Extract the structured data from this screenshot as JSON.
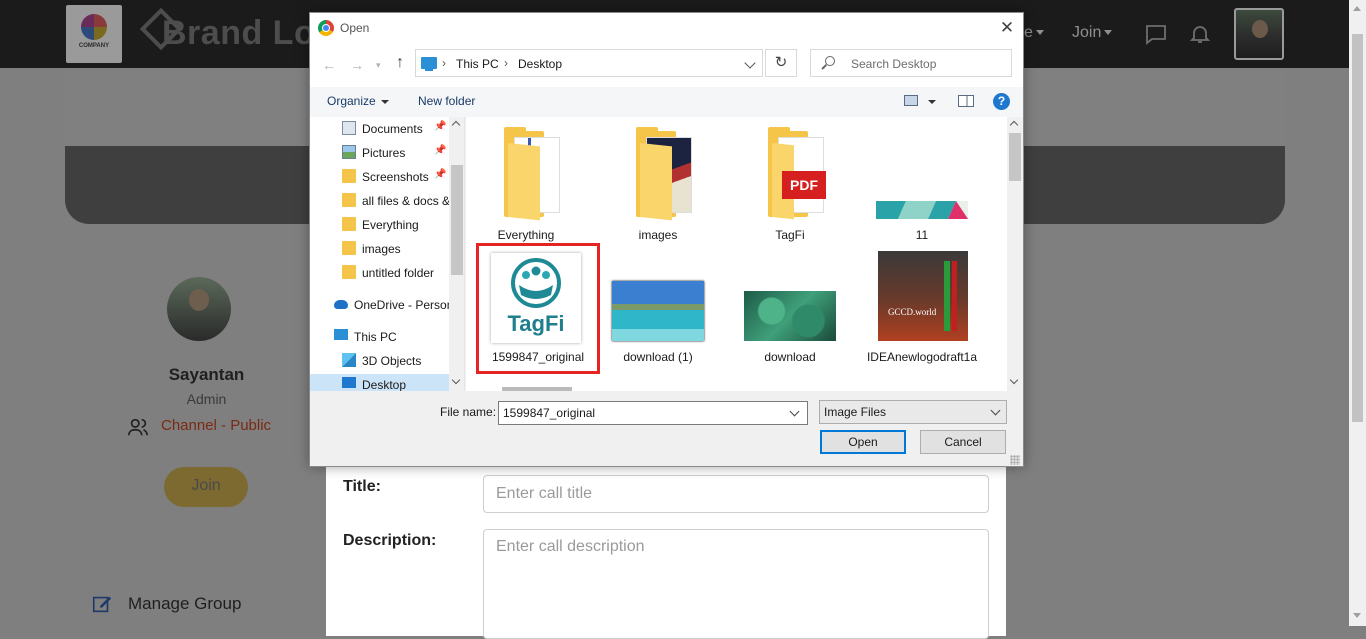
{
  "background_page": {
    "company_logo_text": "COMPANY",
    "brand_text": "Brand Lo",
    "nav_fragment": "e",
    "nav_join": "Join",
    "profile": {
      "name": "Sayantan",
      "role": "Admin",
      "channel": "Channel - Public",
      "join_button": "Join"
    },
    "manage_group": "Manage Group",
    "form": {
      "title_label": "Title:",
      "title_placeholder": "Enter call title",
      "description_label": "Description:",
      "description_placeholder": "Enter call description"
    }
  },
  "dialog": {
    "title": "Open",
    "close_glyph": "✕",
    "address": {
      "crumbs": [
        "This PC",
        "Desktop"
      ],
      "separator": "›"
    },
    "refresh_glyph": "↻",
    "search_placeholder": "Search Desktop",
    "toolbar": {
      "organize": "Organize",
      "new_folder": "New folder",
      "help": "?"
    },
    "nav_items": [
      {
        "label": "Documents",
        "icon": "documents-icon",
        "pinned": true
      },
      {
        "label": "Pictures",
        "icon": "pictures-icon",
        "pinned": true
      },
      {
        "label": "Screenshots",
        "icon": "folder-icon",
        "pinned": true
      },
      {
        "label": "all files & docs &",
        "icon": "folder-icon",
        "pinned": false
      },
      {
        "label": "Everything",
        "icon": "folder-icon",
        "pinned": false
      },
      {
        "label": "images",
        "icon": "folder-icon",
        "pinned": false
      },
      {
        "label": "untitled folder",
        "icon": "folder-icon",
        "pinned": false
      },
      {
        "label": "OneDrive - Person",
        "icon": "onedrive-icon",
        "pinned": false
      },
      {
        "label": "This PC",
        "icon": "this-pc-icon",
        "pinned": false
      },
      {
        "label": "3D Objects",
        "icon": "3d-objects-icon",
        "pinned": false
      },
      {
        "label": "Desktop",
        "icon": "desktop-icon",
        "pinned": false,
        "selected": true
      }
    ],
    "files": [
      {
        "label": "Everything",
        "kind": "folder"
      },
      {
        "label": "images",
        "kind": "folder"
      },
      {
        "label": "TagFi",
        "kind": "folder",
        "badge": "PDF"
      },
      {
        "label": "11",
        "kind": "image"
      },
      {
        "label": "1599847_original",
        "kind": "image",
        "selected": true,
        "logo_text": "TagFi"
      },
      {
        "label": "download (1)",
        "kind": "image"
      },
      {
        "label": "download",
        "kind": "image"
      },
      {
        "label": "IDEAnewlogodraft1a",
        "kind": "image",
        "caption": "GCCD.world"
      }
    ],
    "file_name_label": "File name:",
    "file_name_value": "1599847_original",
    "file_type": "Image Files",
    "open_button": "Open",
    "cancel_button": "Cancel"
  },
  "colors": {
    "selection_outline": "#e52424",
    "nav_selected_bg": "#cce4f7",
    "folder_yellow": "#f5c54a",
    "tagfi_teal": "#1f8a96"
  }
}
